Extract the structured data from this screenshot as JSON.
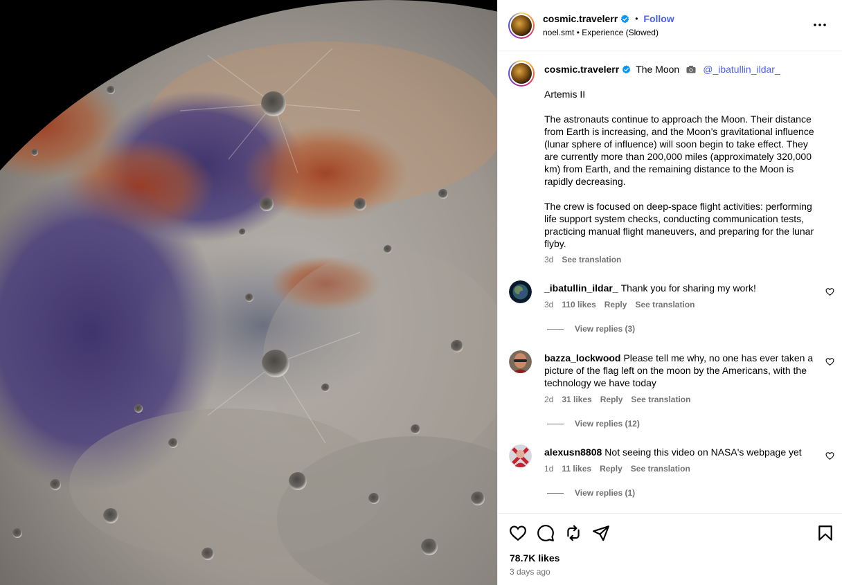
{
  "post_header": {
    "username": "cosmic.travelerr",
    "follow_label": "Follow",
    "audio_artist": "noel.smt",
    "audio_title": "Experience (Slowed)"
  },
  "caption": {
    "username": "cosmic.travelerr",
    "title": "The Moon",
    "mention": "@_ibatullin_ildar_",
    "heading": "Artemis II",
    "paragraph1": "The astronauts continue to approach the Moon. Their distance from Earth is increasing, and the Moon’s gravitational influence (lunar sphere of influence) will soon begin to take effect. They are currently more than 200,000 miles (approximately 320,000 km) from Earth, and the remaining distance to the Moon is rapidly decreasing.",
    "paragraph2": "The crew is focused on deep-space flight activities: performing life support system checks, conducting communication tests, practicing manual flight maneuvers, and preparing for the lunar flyby.",
    "age": "3d",
    "see_translation": "See translation"
  },
  "comments": [
    {
      "username": "_ibatullin_ildar_",
      "text": "Thank you for sharing my work!",
      "age": "3d",
      "likes": "110 likes",
      "reply_label": "Reply",
      "see_translation": "See translation",
      "view_replies": "View replies (3)"
    },
    {
      "username": "bazza_lockwood",
      "text": "Please tell me why, no one has ever taken a picture of the flag left on the moon by the Americans, with the technology we have today",
      "age": "2d",
      "likes": "31 likes",
      "reply_label": "Reply",
      "see_translation": "See translation",
      "view_replies": "View replies (12)"
    },
    {
      "username": "alexusn8808",
      "text": "Not seeing this video on NASA's webpage yet",
      "age": "1d",
      "likes": "11 likes",
      "reply_label": "Reply",
      "see_translation": "See translation",
      "view_replies": "View replies (1)"
    }
  ],
  "footer": {
    "likes": "78.7K likes",
    "time": "3 days ago"
  },
  "icons": {
    "like": "heart-icon",
    "comment": "comment-icon",
    "repost": "repost-icon",
    "share": "share-icon",
    "save": "bookmark-icon",
    "more": "more-icon",
    "verified": "verified-badge-icon"
  },
  "colors": {
    "link_blue": "#4a5df9",
    "verified_blue": "#0095f6",
    "secondary_text": "#737373"
  }
}
